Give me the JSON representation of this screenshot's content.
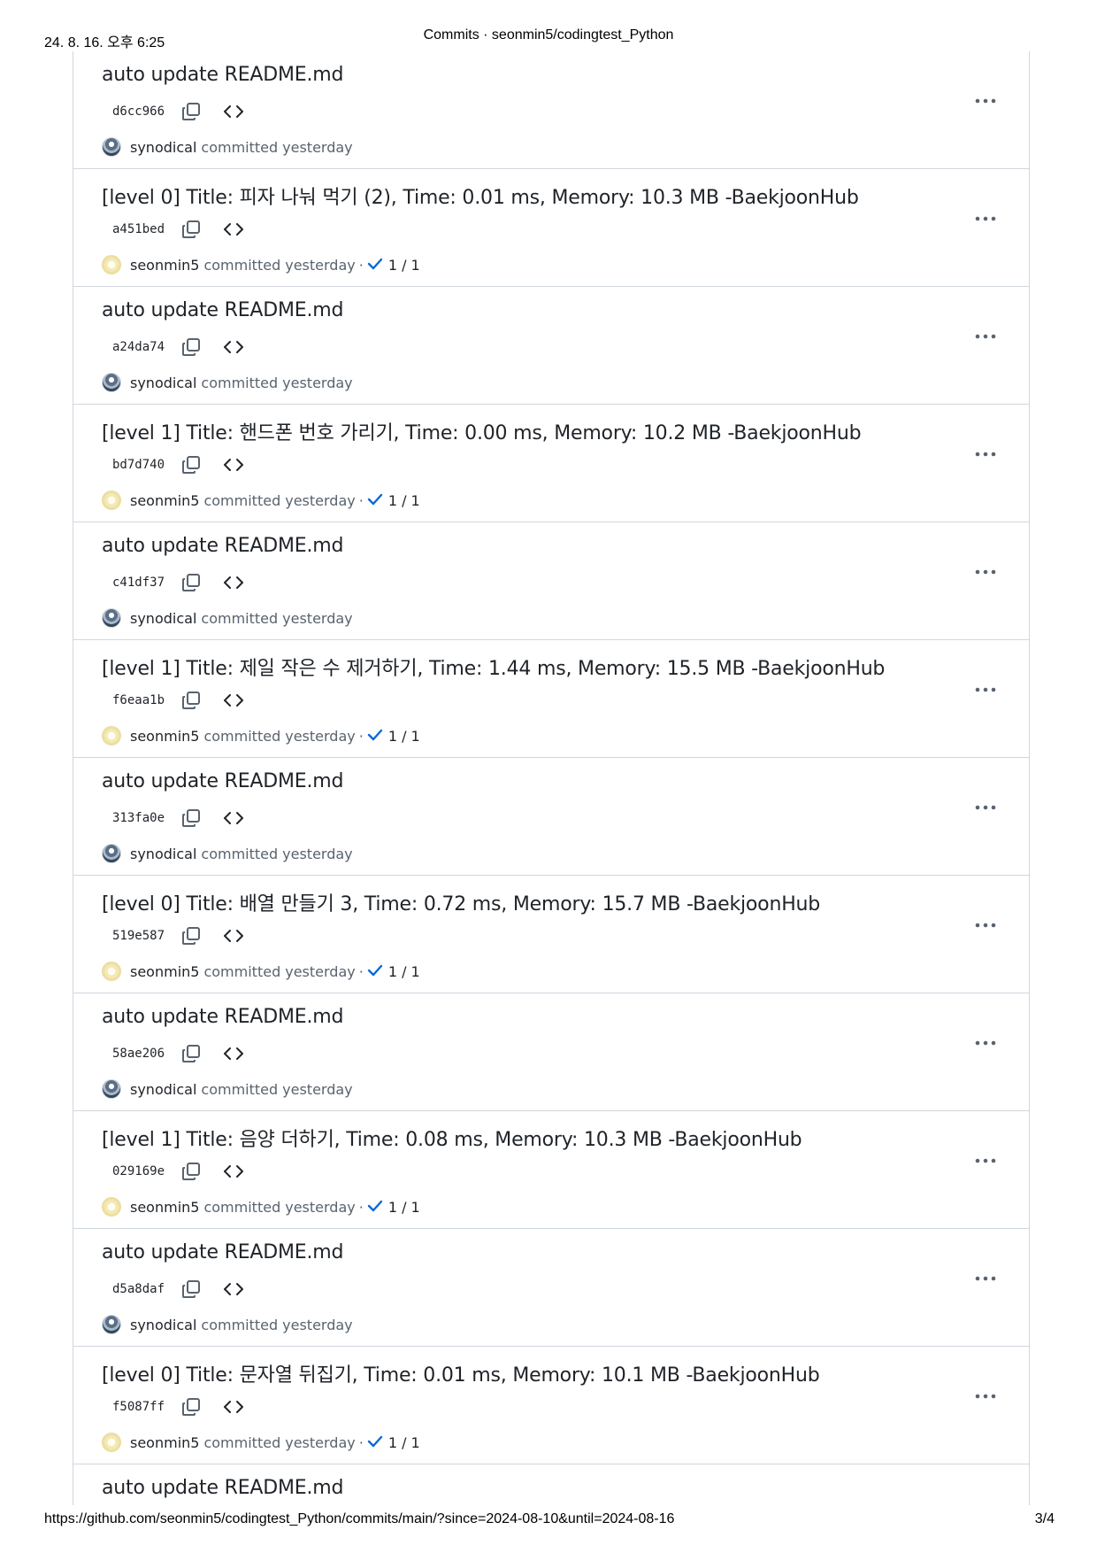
{
  "print_header": {
    "date": "24. 8. 16. 오후 6:25",
    "title": "Commits · seonmin5/codingtest_Python"
  },
  "print_footer": {
    "url": "https://github.com/seonmin5/codingtest_Python/commits/main/?since=2024-08-10&until=2024-08-16",
    "page": "3/4"
  },
  "labels": {
    "committed": "committed",
    "separator": "·"
  },
  "icons": {
    "copy": "copy-icon",
    "browse": "code-brackets-icon",
    "more": "kebab-horizontal-icon",
    "check": "check-icon"
  },
  "colors": {
    "check": "#0969da",
    "border": "#d0d7de",
    "muted_text": "#59636e"
  },
  "commits": [
    {
      "title": "auto update README.md",
      "sha": "d6cc966",
      "author": "synodical",
      "time": "yesterday",
      "checks": ""
    },
    {
      "title": "[level 0] Title: 피자 나눠 먹기 (2), Time: 0.01 ms, Memory: 10.3 MB -BaekjoonHub",
      "sha": "a451bed",
      "author": "seonmin5",
      "time": "yesterday",
      "checks": "1 / 1"
    },
    {
      "title": "auto update README.md",
      "sha": "a24da74",
      "author": "synodical",
      "time": "yesterday",
      "checks": ""
    },
    {
      "title": "[level 1] Title: 핸드폰 번호 가리기, Time: 0.00 ms, Memory: 10.2 MB -BaekjoonHub",
      "sha": "bd7d740",
      "author": "seonmin5",
      "time": "yesterday",
      "checks": "1 / 1"
    },
    {
      "title": "auto update README.md",
      "sha": "c41df37",
      "author": "synodical",
      "time": "yesterday",
      "checks": ""
    },
    {
      "title": "[level 1] Title: 제일 작은 수 제거하기, Time: 1.44 ms, Memory: 15.5 MB -BaekjoonHub",
      "sha": "f6eaa1b",
      "author": "seonmin5",
      "time": "yesterday",
      "checks": "1 / 1"
    },
    {
      "title": "auto update README.md",
      "sha": "313fa0e",
      "author": "synodical",
      "time": "yesterday",
      "checks": ""
    },
    {
      "title": "[level 0] Title: 배열 만들기 3, Time: 0.72 ms, Memory: 15.7 MB -BaekjoonHub",
      "sha": "519e587",
      "author": "seonmin5",
      "time": "yesterday",
      "checks": "1 / 1"
    },
    {
      "title": "auto update README.md",
      "sha": "58ae206",
      "author": "synodical",
      "time": "yesterday",
      "checks": ""
    },
    {
      "title": "[level 1] Title: 음양 더하기, Time: 0.08 ms, Memory: 10.3 MB -BaekjoonHub",
      "sha": "029169e",
      "author": "seonmin5",
      "time": "yesterday",
      "checks": "1 / 1"
    },
    {
      "title": "auto update README.md",
      "sha": "d5a8daf",
      "author": "synodical",
      "time": "yesterday",
      "checks": ""
    },
    {
      "title": "[level 0] Title: 문자열 뒤집기, Time: 0.01 ms, Memory: 10.1 MB -BaekjoonHub",
      "sha": "f5087ff",
      "author": "seonmin5",
      "time": "yesterday",
      "checks": "1 / 1"
    },
    {
      "title": "auto update README.md",
      "sha": "",
      "author": "",
      "time": "",
      "checks": ""
    }
  ]
}
